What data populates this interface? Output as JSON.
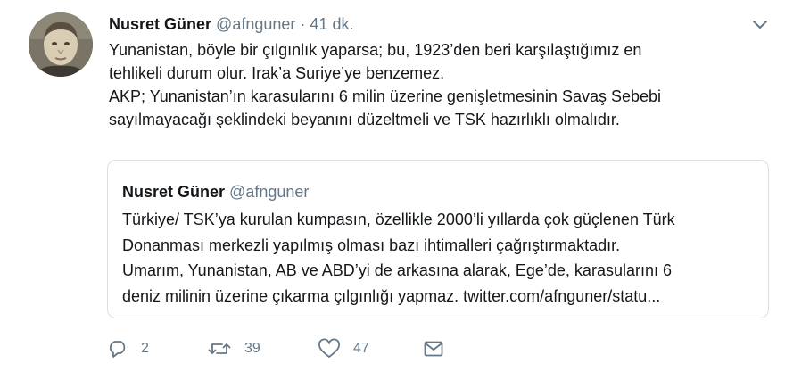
{
  "tweet": {
    "author_name": "Nusret Güner",
    "author_handle": "@afnguner",
    "separator": "·",
    "time": "41 dk.",
    "lines": [
      "Yunanistan, böyle bir çılgınlık yaparsa; bu, 1923’den beri karşılaştığımız  en",
      "tehlikeli durum olur. Irak’a Suriye’ye benzemez.",
      "AKP; Yunanistan’ın karasularını 6 milin üzerine genişletmesinin Savaş Sebebi",
      "sayılmayacağı şeklindeki beyanını düzeltmeli ve TSK hazırlıklı olmalıdır."
    ]
  },
  "quoted": {
    "author_name": "Nusret Güner",
    "author_handle": "@afnguner",
    "lines": [
      "Türkiye/ TSK’ya kurulan kumpasın, özellikle 2000’li yıllarda çok güçlenen Türk",
      "Donanması merkezli yapılmış olması bazı ihtimalleri çağrıştırmaktadır.",
      "Umarım, Yunanistan, AB ve ABD’yi de arkasına alarak, Ege’de, karasularını 6",
      "deniz milinin üzerine çıkarma çılgınlığı yapmaz. twitter.com/afnguner/statu..."
    ]
  },
  "actions": {
    "reply_count": "2",
    "retweet_count": "39",
    "like_count": "47"
  },
  "icons": {
    "reply": "reply-icon",
    "retweet": "retweet-icon",
    "like": "heart-icon",
    "dm": "envelope-icon",
    "menu": "chevron-down-icon"
  },
  "colors": {
    "text": "#14171a",
    "secondary": "#657786",
    "border": "#d8e0e6"
  }
}
